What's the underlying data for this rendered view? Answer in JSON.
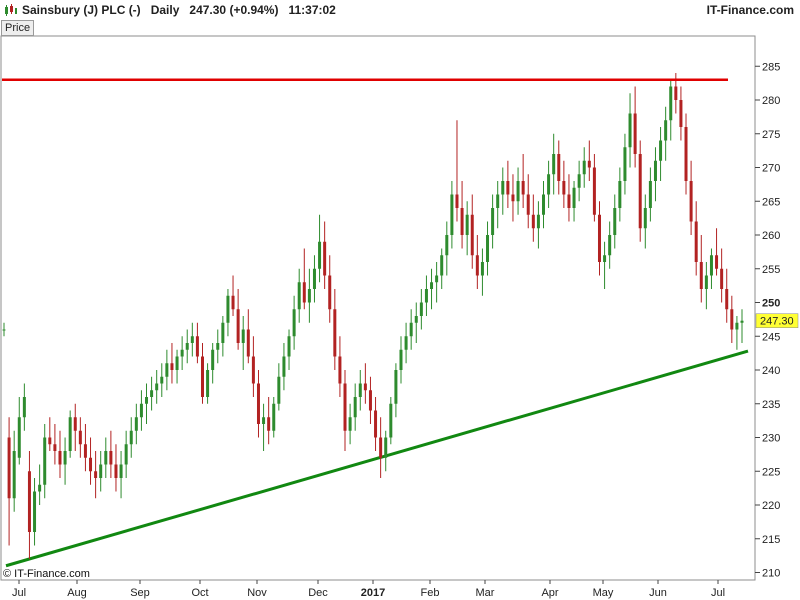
{
  "header": {
    "title": "Sainsbury (J) PLC (-)",
    "period": "Daily",
    "last": "247.30 (+0.94%)",
    "time": "11:37:02",
    "brand": "IT-Finance.com"
  },
  "panel": {
    "tab_label": "Price"
  },
  "watermark": "© IT-Finance.com",
  "colors": {
    "up": "#2e8b2e",
    "down": "#b22222",
    "resistance": "#e00000",
    "support": "#118811",
    "price_box": "#ffff33"
  },
  "chart_data": {
    "type": "candlestick",
    "y_ticks": [
      210,
      215,
      220,
      225,
      230,
      235,
      240,
      245,
      250,
      255,
      260,
      265,
      270,
      275,
      280,
      285
    ],
    "y_bold_tick": 250,
    "ylim": [
      209,
      287
    ],
    "x_ticks": [
      "Jul",
      "Aug",
      "Sep",
      "Oct",
      "Nov",
      "Dec",
      "2017",
      "Feb",
      "Mar",
      "Apr",
      "May",
      "Jun",
      "Jul"
    ],
    "x_bold_tick": "2017",
    "grid": false,
    "last_price_label": "247.30",
    "last_price": 247.3,
    "resistance_level": 283.0,
    "support_line": {
      "from": 211.0,
      "to": 242.8
    },
    "candles": [
      [
        246,
        247,
        245,
        246
      ],
      [
        230,
        233,
        214,
        221
      ],
      [
        221,
        231,
        219,
        228
      ],
      [
        227,
        236,
        226,
        233
      ],
      [
        233,
        238,
        231,
        236
      ],
      [
        225,
        228,
        212,
        216
      ],
      [
        216,
        224,
        214,
        222
      ],
      [
        222,
        226,
        220,
        223
      ],
      [
        223,
        232,
        221,
        230
      ],
      [
        230,
        233,
        228,
        229
      ],
      [
        229,
        232,
        226,
        228
      ],
      [
        228,
        231,
        224,
        226
      ],
      [
        226,
        230,
        223,
        228
      ],
      [
        228,
        234,
        227,
        233
      ],
      [
        233,
        235,
        228,
        231
      ],
      [
        231,
        233,
        227,
        229
      ],
      [
        229,
        232,
        225,
        227
      ],
      [
        227,
        230,
        223,
        225
      ],
      [
        225,
        228,
        221,
        224
      ],
      [
        224,
        228,
        222,
        226
      ],
      [
        226,
        230,
        224,
        228
      ],
      [
        228,
        231,
        224,
        226
      ],
      [
        226,
        229,
        222,
        224
      ],
      [
        224,
        228,
        221,
        226
      ],
      [
        226,
        231,
        224,
        229
      ],
      [
        229,
        233,
        227,
        231
      ],
      [
        231,
        235,
        229,
        233
      ],
      [
        233,
        237,
        231,
        235
      ],
      [
        235,
        238,
        232,
        236
      ],
      [
        236,
        239,
        234,
        237
      ],
      [
        237,
        240,
        235,
        238
      ],
      [
        238,
        241,
        236,
        239
      ],
      [
        239,
        243,
        237,
        241
      ],
      [
        241,
        244,
        238,
        240
      ],
      [
        240,
        243,
        238,
        242
      ],
      [
        242,
        245,
        240,
        243
      ],
      [
        243,
        246,
        241,
        244
      ],
      [
        244,
        247,
        242,
        245
      ],
      [
        245,
        247,
        241,
        242
      ],
      [
        242,
        244,
        235,
        236
      ],
      [
        236,
        241,
        235,
        240
      ],
      [
        240,
        244,
        238,
        243
      ],
      [
        243,
        246,
        241,
        244
      ],
      [
        244,
        248,
        242,
        247
      ],
      [
        247,
        252,
        245,
        251
      ],
      [
        251,
        254,
        248,
        249
      ],
      [
        249,
        252,
        243,
        244
      ],
      [
        244,
        248,
        240,
        246
      ],
      [
        246,
        249,
        241,
        242
      ],
      [
        242,
        245,
        236,
        238
      ],
      [
        238,
        240,
        230,
        232
      ],
      [
        232,
        235,
        228,
        233
      ],
      [
        233,
        236,
        229,
        231
      ],
      [
        231,
        236,
        230,
        235
      ],
      [
        235,
        241,
        234,
        239
      ],
      [
        239,
        244,
        237,
        242
      ],
      [
        242,
        246,
        240,
        245
      ],
      [
        245,
        251,
        243,
        249
      ],
      [
        249,
        255,
        247,
        253
      ],
      [
        253,
        258,
        249,
        250
      ],
      [
        250,
        255,
        247,
        252
      ],
      [
        252,
        257,
        250,
        255
      ],
      [
        255,
        263,
        253,
        259
      ],
      [
        259,
        262,
        252,
        254
      ],
      [
        254,
        257,
        247,
        249
      ],
      [
        249,
        252,
        240,
        242
      ],
      [
        242,
        245,
        236,
        238
      ],
      [
        238,
        240,
        228,
        231
      ],
      [
        231,
        235,
        229,
        233
      ],
      [
        233,
        238,
        231,
        236
      ],
      [
        236,
        240,
        234,
        238
      ],
      [
        238,
        241,
        235,
        237
      ],
      [
        237,
        239,
        232,
        234
      ],
      [
        234,
        236,
        228,
        230
      ],
      [
        230,
        233,
        224,
        227
      ],
      [
        227,
        231,
        225,
        230
      ],
      [
        230,
        236,
        229,
        235
      ],
      [
        235,
        241,
        233,
        240
      ],
      [
        240,
        245,
        238,
        243
      ],
      [
        243,
        247,
        241,
        245
      ],
      [
        245,
        249,
        243,
        247
      ],
      [
        247,
        250,
        244,
        248
      ],
      [
        248,
        252,
        246,
        250
      ],
      [
        250,
        254,
        248,
        252
      ],
      [
        252,
        255,
        249,
        253
      ],
      [
        253,
        256,
        250,
        254
      ],
      [
        254,
        258,
        252,
        257
      ],
      [
        257,
        262,
        254,
        260
      ],
      [
        260,
        268,
        258,
        266
      ],
      [
        266,
        277,
        262,
        264
      ],
      [
        264,
        268,
        258,
        260
      ],
      [
        260,
        265,
        257,
        263
      ],
      [
        263,
        266,
        255,
        257
      ],
      [
        257,
        260,
        252,
        254
      ],
      [
        254,
        258,
        251,
        256
      ],
      [
        256,
        262,
        254,
        260
      ],
      [
        260,
        266,
        258,
        264
      ],
      [
        264,
        268,
        261,
        266
      ],
      [
        266,
        270,
        263,
        268
      ],
      [
        268,
        271,
        264,
        266
      ],
      [
        266,
        269,
        262,
        265
      ],
      [
        265,
        270,
        263,
        268
      ],
      [
        268,
        272,
        264,
        266
      ],
      [
        266,
        269,
        261,
        263
      ],
      [
        263,
        266,
        259,
        261
      ],
      [
        261,
        265,
        258,
        263
      ],
      [
        263,
        268,
        261,
        266
      ],
      [
        266,
        271,
        264,
        269
      ],
      [
        269,
        275,
        266,
        272
      ],
      [
        272,
        274,
        266,
        268
      ],
      [
        268,
        271,
        264,
        266
      ],
      [
        266,
        269,
        262,
        264
      ],
      [
        264,
        268,
        262,
        267
      ],
      [
        267,
        271,
        265,
        269
      ],
      [
        269,
        273,
        267,
        271
      ],
      [
        271,
        274,
        268,
        270
      ],
      [
        270,
        272,
        262,
        263
      ],
      [
        263,
        265,
        254,
        256
      ],
      [
        256,
        259,
        252,
        257
      ],
      [
        257,
        262,
        255,
        260
      ],
      [
        260,
        266,
        258,
        264
      ],
      [
        264,
        270,
        262,
        268
      ],
      [
        268,
        275,
        266,
        273
      ],
      [
        273,
        281,
        270,
        278
      ],
      [
        278,
        282,
        270,
        272
      ],
      [
        272,
        274,
        259,
        261
      ],
      [
        261,
        266,
        258,
        264
      ],
      [
        264,
        270,
        262,
        268
      ],
      [
        268,
        273,
        265,
        271
      ],
      [
        271,
        276,
        268,
        274
      ],
      [
        274,
        279,
        271,
        277
      ],
      [
        277,
        283,
        274,
        282
      ],
      [
        282,
        284,
        278,
        280
      ],
      [
        280,
        282,
        274,
        276
      ],
      [
        276,
        278,
        266,
        268
      ],
      [
        268,
        271,
        260,
        262
      ],
      [
        262,
        265,
        254,
        256
      ],
      [
        256,
        260,
        250,
        252
      ],
      [
        252,
        256,
        249,
        254
      ],
      [
        254,
        258,
        252,
        257
      ],
      [
        257,
        261,
        254,
        255
      ],
      [
        255,
        258,
        250,
        252
      ],
      [
        252,
        255,
        247,
        249
      ],
      [
        249,
        251,
        244,
        246
      ],
      [
        246,
        248,
        243,
        247
      ],
      [
        247,
        249,
        244,
        247.3
      ]
    ]
  }
}
